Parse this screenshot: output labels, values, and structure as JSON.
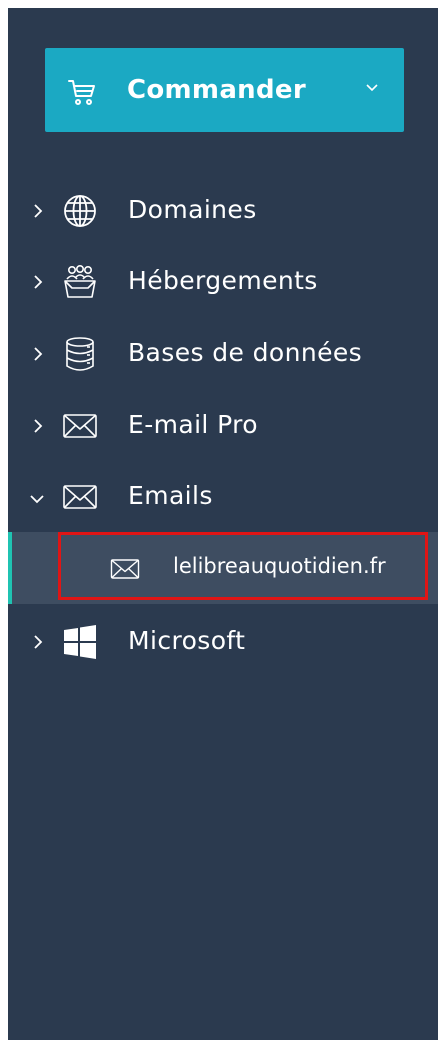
{
  "order_button": {
    "label": "Commander",
    "icon": "cart-icon",
    "dropdown_icon": "chevron-down-icon"
  },
  "menu": [
    {
      "label": "Domaines",
      "icon": "globe-icon",
      "expanded": false
    },
    {
      "label": "Hébergements",
      "icon": "people-box-icon",
      "expanded": false
    },
    {
      "label": "Bases de données",
      "icon": "database-icon",
      "expanded": false
    },
    {
      "label": "E-mail Pro",
      "icon": "envelope-icon",
      "expanded": false
    },
    {
      "label": "Emails",
      "icon": "envelope-icon",
      "expanded": true,
      "children": [
        {
          "label": "lelibreauquotidien.fr",
          "icon": "envelope-icon",
          "active": true
        }
      ]
    },
    {
      "label": "Microsoft",
      "icon": "windows-icon",
      "expanded": false
    }
  ],
  "colors": {
    "sidebar_bg": "#2b3a4f",
    "accent": "#1ba9c3",
    "active_bg": "#3e4d61",
    "active_indicator": "#1fc3b2",
    "highlight_border": "#e01515",
    "text": "#ffffff"
  }
}
